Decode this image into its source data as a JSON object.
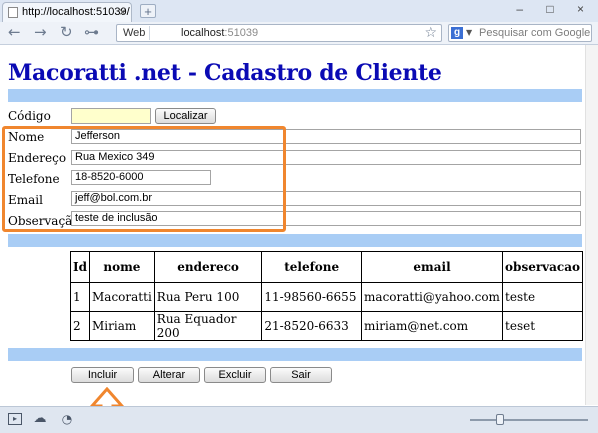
{
  "browser": {
    "tab_title": "http://localhost:51039/",
    "tab_close": "×",
    "new_tab": "+",
    "window_controls": "‒ □ ×",
    "back": "←",
    "forward": "→",
    "reload": "↻",
    "key": "⊶",
    "web_chip": "Web",
    "url_host": "localhost",
    "url_port": ":51039",
    "star": "☆",
    "search_engine": "g",
    "search_placeholder": "Pesquisar com Google"
  },
  "page": {
    "title": "Macoratti .net - Cadastro de Cliente",
    "codigo_label": "Código",
    "codigo_value": "",
    "localizar_button": "Localizar",
    "fields": [
      {
        "label": "Nome",
        "value": "Jefferson"
      },
      {
        "label": "Endereço",
        "value": "Rua Mexico 349"
      },
      {
        "label": "Telefone",
        "value": "18-8520-6000"
      },
      {
        "label": "Email",
        "value": "jeff@bol.com.br"
      },
      {
        "label": "Observação",
        "value": "teste de inclusão"
      }
    ],
    "highlight_color": "#f0862e",
    "band_color": "#a9cdf5",
    "title_color": "#0a0ab4",
    "table": {
      "headers": [
        "Id",
        "nome",
        "endereco",
        "telefone",
        "email",
        "observacao"
      ],
      "rows": [
        [
          "1",
          "Macoratti",
          "Rua Peru 100",
          "11-98560-6655",
          "macoratti@yahoo.com",
          "teste"
        ],
        [
          "2",
          "Miriam",
          "Rua Equador 200",
          "21-8520-6633",
          "miriam@net.com",
          "teset"
        ]
      ]
    },
    "buttons": {
      "incluir": "Incluir",
      "alterar": "Alterar",
      "excluir": "Excluir",
      "sair": "Sair"
    },
    "arrow_icon": "up-arrow-outline"
  },
  "statusbar": {
    "icons": [
      "console-icon",
      "cloud-icon",
      "speed-icon"
    ],
    "zoom_level": 0.25
  }
}
